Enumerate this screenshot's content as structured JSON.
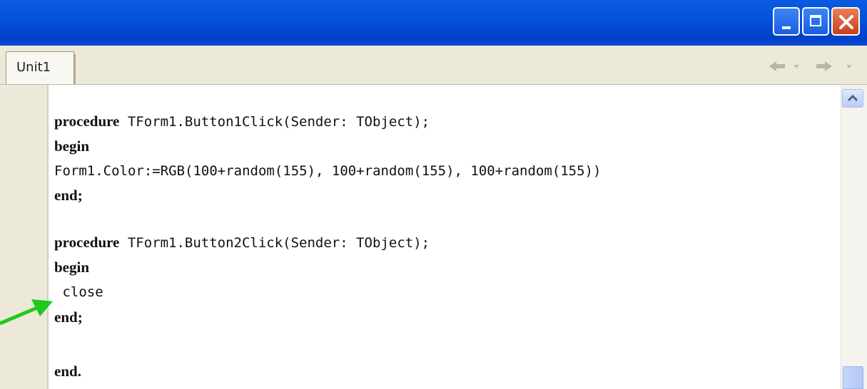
{
  "window": {
    "tab_label": "Unit1"
  },
  "code": {
    "l1_kw": "procedure",
    "l1_rest": " TForm1.Button1Click(Sender: TObject);",
    "l2_kw": "begin",
    "l3": "Form1.Color:=RGB(100+random(155), 100+random(155), 100+random(155))",
    "l4_kw": "end",
    "l4_rest": ";",
    "l6_kw": "procedure",
    "l6_rest": " TForm1.Button2Click(Sender: TObject);",
    "l7_kw": "begin",
    "l8": " close",
    "l9_kw": "end",
    "l9_rest": ";",
    "l11_kw": "end",
    "l11_rest": "."
  },
  "icons": {
    "minimize": "minimize-icon",
    "maximize": "maximize-icon",
    "close": "close-icon",
    "back": "back-arrow-icon",
    "forward": "forward-arrow-icon",
    "pointer": "green-arrow-icon"
  },
  "colors": {
    "titlebar": "#0552dc",
    "editor_bg": "#ffffff",
    "pointer_arrow": "#1ec81e"
  }
}
